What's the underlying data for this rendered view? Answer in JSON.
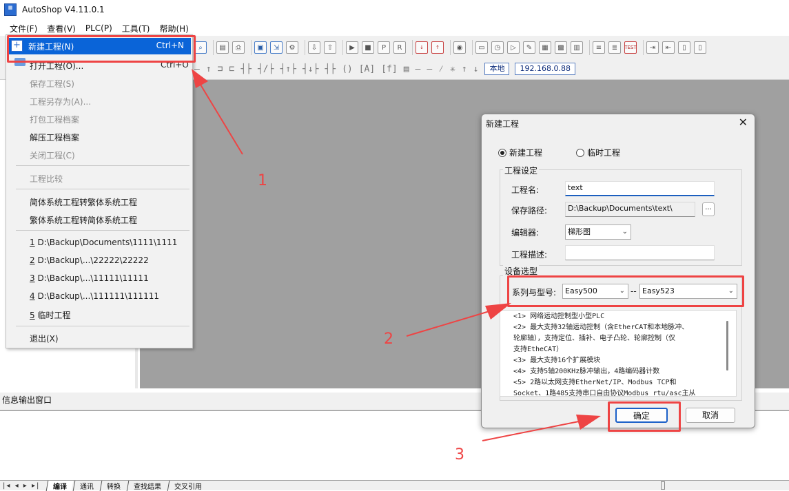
{
  "window": {
    "title": "AutoShop V4.11.0.1",
    "logo_icon": "autoshop-logo-icon"
  },
  "menubar": [
    "文件(F)",
    "查看(V)",
    "PLC(P)",
    "工具(T)",
    "帮助(H)"
  ],
  "toolbar": {
    "status_local": "本地",
    "ip_address": "192.168.0.88",
    "test_label": "TEST"
  },
  "file_menu": {
    "new_project": {
      "label": "新建工程(N)",
      "shortcut": "Ctrl+N"
    },
    "open_project": {
      "label": "打开工程(O)...",
      "shortcut": "Ctrl+O"
    },
    "save_project": "保存工程(S)",
    "save_as": "工程另存为(A)...",
    "pack_archive": "打包工程档案",
    "unpack_archive": "解压工程档案",
    "close_project": "关闭工程(C)",
    "compare": "工程比较",
    "to_traditional": "简体系统工程转繁体系统工程",
    "to_simplified": "繁体系统工程转简体系统工程",
    "recent": [
      {
        "num": "1",
        "path": "D:\\Backup\\Documents\\1111\\1111"
      },
      {
        "num": "2",
        "path": "D:\\Backup\\...\\22222\\22222"
      },
      {
        "num": "3",
        "path": "D:\\Backup\\...\\11111\\11111"
      },
      {
        "num": "4",
        "path": "D:\\Backup\\...\\111111\\111111"
      },
      {
        "num": "5",
        "path": "临时工程"
      }
    ],
    "exit": "退出(X)"
  },
  "dialog": {
    "title": "新建工程",
    "radio_new": "新建工程",
    "radio_temp": "临时工程",
    "group_settings": "工程设定",
    "name_label": "工程名:",
    "name_value": "text",
    "path_label": "保存路径:",
    "path_value": "D:\\Backup\\Documents\\text\\",
    "browse": "...",
    "editor_label": "编辑器:",
    "editor_value": "梯形图",
    "desc_label": "工程描述:",
    "desc_value": "",
    "group_device": "设备选型",
    "series_label": "系列与型号:",
    "series_value": "Easy500",
    "sep": "--",
    "model_value": "Easy523",
    "description_lines": [
      "<1> 网络运动控制型小型PLC",
      "<2> 最大支持32轴运动控制（含EtherCAT和本地脉冲、",
      "轮廓轴），支持定位、插补、电子凸轮、轮廓控制（仅",
      "支持EtheCAT）",
      "<3> 最大支持16个扩展模块",
      "<4> 支持5轴200KHz脉冲输出，4路编码器计数",
      "<5> 2路以太网支持EtherNet/IP、Modbus TCP和",
      "Socket、1路485支持串口自由协议Modbus rtu/asc主从"
    ],
    "ok": "确定",
    "cancel": "取消"
  },
  "output_window": {
    "title": "信息输出窗口"
  },
  "status_tabs": [
    "编译",
    "通讯",
    "转换",
    "查找结果",
    "交叉引用"
  ],
  "annotations": {
    "n1": "1",
    "n2": "2",
    "n3": "3",
    "color": "#ee4444"
  }
}
